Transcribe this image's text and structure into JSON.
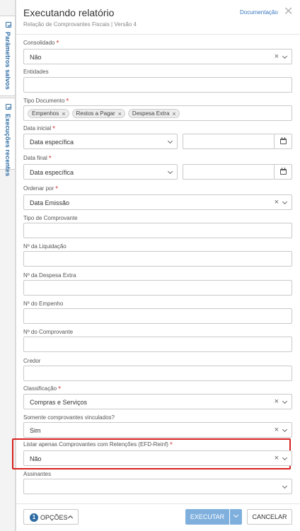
{
  "side_tabs": {
    "saved_params": "Parâmetros salvos",
    "recent_runs": "Execuções recentes"
  },
  "header": {
    "title": "Executando relatório",
    "subtitle": "Relação de Comprovantes Fiscais | Versão 4",
    "doc_link": "Documentação",
    "close_glyph": "✕"
  },
  "required_mark": "*",
  "fields": {
    "consolidado": {
      "label": "Consolidado",
      "value": "Não"
    },
    "entidades": {
      "label": "Entidades",
      "value": ""
    },
    "tipo_documento": {
      "label": "Tipo Documento",
      "chips": [
        "Empenhos",
        "Restos a Pagar",
        "Despesa Extra"
      ]
    },
    "data_inicial": {
      "label": "Data inicial",
      "value": "Data específica",
      "date": ""
    },
    "data_final": {
      "label": "Data final",
      "value": "Data específica",
      "date": ""
    },
    "ordenar_por": {
      "label": "Ordenar por",
      "value": "Data Emissão"
    },
    "tipo_comprovante": {
      "label": "Tipo de Comprovante",
      "value": ""
    },
    "n_liquidacao": {
      "label": "Nº da Liquidação",
      "value": ""
    },
    "n_despesa_extra": {
      "label": "Nº da Despesa Extra",
      "value": ""
    },
    "n_empenho": {
      "label": "Nº do Empenho",
      "value": ""
    },
    "n_comprovante": {
      "label": "Nº do Comprovante",
      "value": ""
    },
    "credor": {
      "label": "Credor",
      "value": ""
    },
    "classificacao": {
      "label": "Classificação",
      "value": "Compras e Serviços"
    },
    "somente_vinculados": {
      "label": "Somente comprovantes vinculados?",
      "value": "Sim"
    },
    "listar_retencoes": {
      "label": "Listar apenas Comprovantes com Retenções (EFD-Reinf)",
      "value": "Não"
    },
    "assinantes": {
      "label": "Assinantes",
      "value": ""
    }
  },
  "icons": {
    "clear": "×",
    "chip_remove": "×",
    "dropdown": "chevron-down-icon",
    "calendar": "calendar-icon"
  },
  "footer": {
    "options_count": "1",
    "options_label": "OPÇÕES",
    "execute_label": "EXECUTAR",
    "cancel_label": "CANCELAR"
  },
  "colors": {
    "primary": "#2e6da4",
    "required": "#d23b3b",
    "highlight": "#d81f1f",
    "execute_bg": "#7fb0dd"
  }
}
